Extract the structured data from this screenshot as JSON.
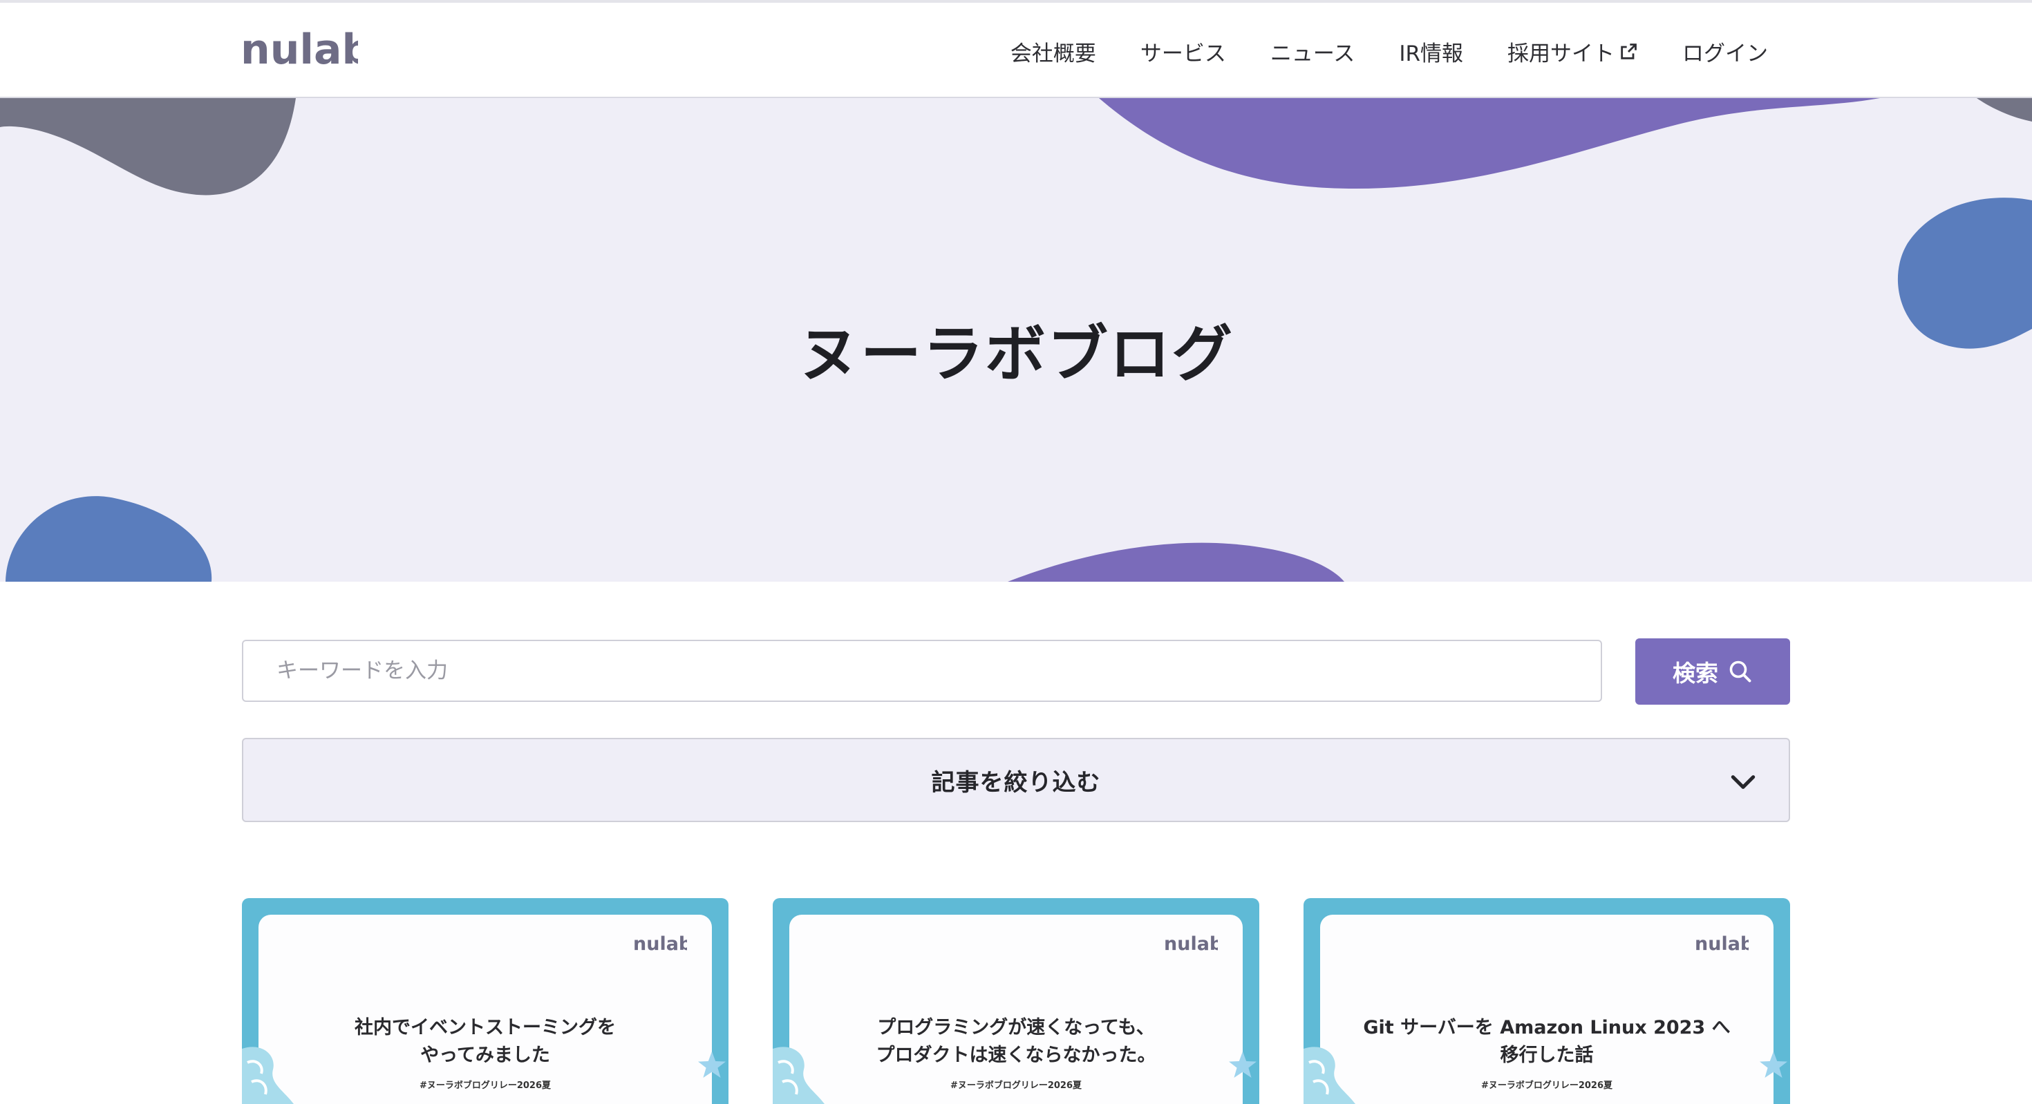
{
  "header": {
    "logo_text": "nulab",
    "nav": [
      {
        "label": "会社概要"
      },
      {
        "label": "サービス"
      },
      {
        "label": "ニュース"
      },
      {
        "label": "IR情報"
      },
      {
        "label": "採用サイト",
        "external": true
      },
      {
        "label": "ログイン"
      }
    ]
  },
  "hero": {
    "title": "ヌーラボブログ"
  },
  "search": {
    "placeholder": "キーワードを入力",
    "value": "",
    "button_label": "検索"
  },
  "filter": {
    "label": "記事を絞り込む"
  },
  "cards": [
    {
      "title": "社内でイベントストーミングを\nやってみました",
      "tag": "#ヌーラボブログリレー2026夏",
      "logo_text": "nulab"
    },
    {
      "title": "プログラミングが速くなっても、\nプロダクトは速くならなかった。",
      "tag": "#ヌーラボブログリレー2026夏",
      "logo_text": "nulab"
    },
    {
      "title": "Git サーバーを Amazon Linux 2023 へ\n移行した話",
      "tag": "#ヌーラボブログリレー2026夏",
      "logo_text": "nulab"
    }
  ],
  "colors": {
    "accent": "#7a6dbd",
    "hero_bg": "#efeef7",
    "blob_gray": "#737485",
    "blob_purple": "#7a6bba",
    "blob_blue": "#5a7dbd",
    "card_frame": "#5fbad6"
  },
  "icons": {
    "search": "search-icon",
    "external": "external-link-icon",
    "chevron": "chevron-down-icon"
  }
}
